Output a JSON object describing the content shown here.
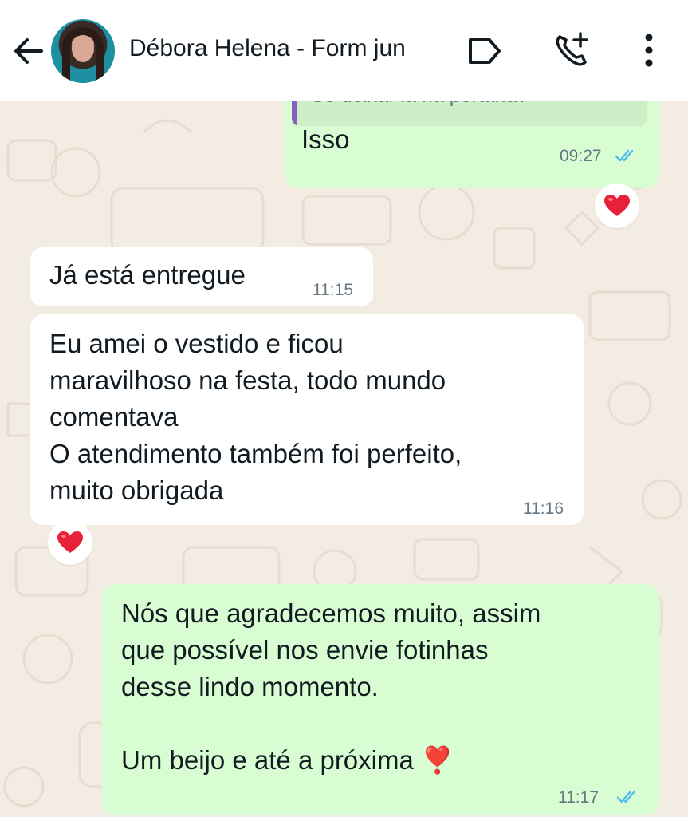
{
  "header": {
    "contact_name": "Débora Helena - Form jun"
  },
  "messages": [
    {
      "direction": "out",
      "quoted_text": "Só deixar lá na portaria?",
      "text": "Isso",
      "time": "09:27",
      "status": "read",
      "reaction": "heart"
    },
    {
      "direction": "in",
      "text": "Já está entregue",
      "time": "11:15"
    },
    {
      "direction": "in",
      "text": "Eu amei o vestido e ficou\nmaravilhoso na festa, todo mundo\ncomentava\nO atendimento também foi perfeito,\nmuito obrigada",
      "time": "11:16",
      "reaction": "heart"
    },
    {
      "direction": "out",
      "text": "Nós que agradecemos muito, assim\nque possível nos envie fotinhas\ndesse lindo momento.\n\nUm beijo e até a próxima ❣️",
      "time": "11:17",
      "status": "read"
    }
  ],
  "colors": {
    "header_bg": "#ffffff",
    "chat_bg": "#f3ece3",
    "outgoing_bubble": "#d9fdd3",
    "incoming_bubble": "#ffffff",
    "read_ticks": "#53bdeb",
    "reaction_heart": "#e8213a",
    "quote_bar": "#8a5cc2"
  },
  "icons": [
    "back-arrow-icon",
    "label-icon",
    "add-call-icon",
    "more-vert-icon",
    "heart-icon",
    "double-check-icon"
  ]
}
